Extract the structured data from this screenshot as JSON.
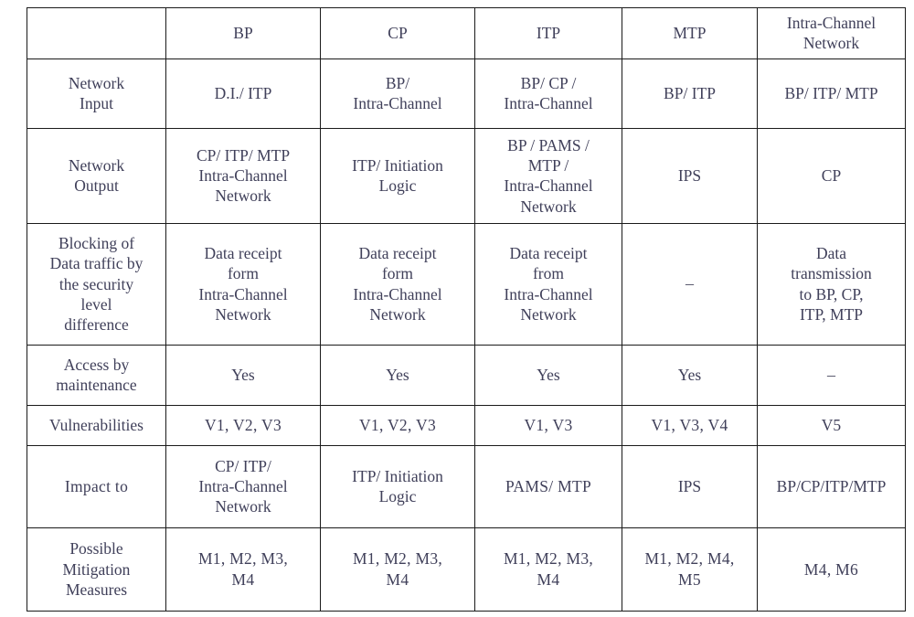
{
  "table": {
    "corner_label": "",
    "columns": [
      "BP",
      "CP",
      "ITP",
      "MTP",
      "Intra-Channel\nNetwork"
    ],
    "rows": [
      {
        "label": "Network\nInput",
        "cells": [
          "D.I./ ITP",
          "BP/\nIntra-Channel",
          "BP/ CP /\nIntra-Channel",
          "BP/ ITP",
          "BP/ ITP/ MTP"
        ]
      },
      {
        "label": "Network\nOutput",
        "cells": [
          "CP/ ITP/ MTP\nIntra-Channel\nNetwork",
          "ITP/ Initiation\nLogic",
          "BP / PAMS /\nMTP /\nIntra-Channel\nNetwork",
          "IPS",
          "CP"
        ]
      },
      {
        "label": "Blocking of\nData traffic by\nthe security\nlevel\ndifference",
        "cells": [
          "Data receipt\nform\nIntra-Channel\nNetwork",
          "Data receipt\nform\nIntra-Channel\nNetwork",
          "Data receipt\nfrom\nIntra-Channel\nNetwork",
          "–",
          "Data\ntransmission\nto BP, CP,\nITP, MTP"
        ]
      },
      {
        "label": "Access by\nmaintenance",
        "cells": [
          "Yes",
          "Yes",
          "Yes",
          "Yes",
          "–"
        ]
      },
      {
        "label": "Vulnerabilities",
        "cells": [
          "V1, V2, V3",
          "V1, V2, V3",
          "V1, V3",
          "V1, V3, V4",
          "V5"
        ]
      },
      {
        "label": "Impact to",
        "cells": [
          "CP/     ITP/\nIntra-Channel\nNetwork",
          "ITP/ Initiation\nLogic",
          "PAMS/ MTP",
          "IPS",
          "BP/CP/ITP/MTP"
        ]
      },
      {
        "label": "Possible\nMitigation\nMeasures",
        "cells": [
          "M1, M2, M3,\nM4",
          "M1, M2, M3,\nM4",
          "M1, M2, M3,\nM4",
          "M1, M2, M4,\nM5",
          "M4, M6"
        ]
      }
    ]
  },
  "style": {
    "border_color": "#1a1a1a",
    "text_color": "#40405a",
    "background": "#ffffff"
  }
}
